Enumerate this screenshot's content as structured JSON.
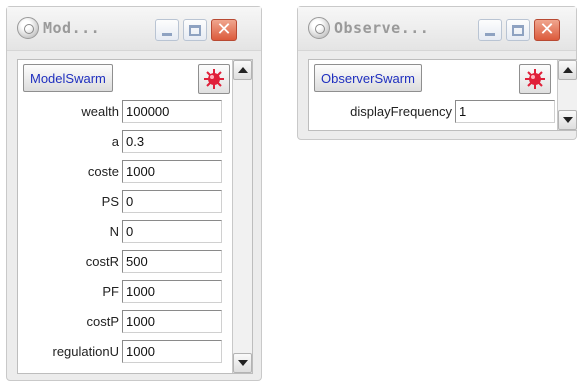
{
  "model_window": {
    "title": "Mod...",
    "swarm_button_label": "ModelSwarm",
    "fields": [
      {
        "label": "wealth",
        "value": "100000"
      },
      {
        "label": "a",
        "value": "0.3"
      },
      {
        "label": "coste",
        "value": "1000"
      },
      {
        "label": "PS",
        "value": "0"
      },
      {
        "label": "N",
        "value": "0"
      },
      {
        "label": "costR",
        "value": "500"
      },
      {
        "label": "PF",
        "value": "1000"
      },
      {
        "label": "costP",
        "value": "1000"
      },
      {
        "label": "regulationU",
        "value": "1000"
      }
    ]
  },
  "observer_window": {
    "title": "Observe...",
    "swarm_button_label": "ObserverSwarm",
    "fields": [
      {
        "label": "displayFrequency",
        "value": "1"
      }
    ]
  },
  "icons": {
    "app": "swarm-app-icon",
    "minimize": "minimize-icon",
    "maximize": "maximize-icon",
    "close": "close-icon",
    "drop": "red-splat-icon",
    "scroll_up": "scroll-up-icon",
    "scroll_down": "scroll-down-icon"
  },
  "colors": {
    "button_text": "#1f2fbf",
    "close_button": "#dc5a3c",
    "drop_icon": "#e0213a"
  }
}
